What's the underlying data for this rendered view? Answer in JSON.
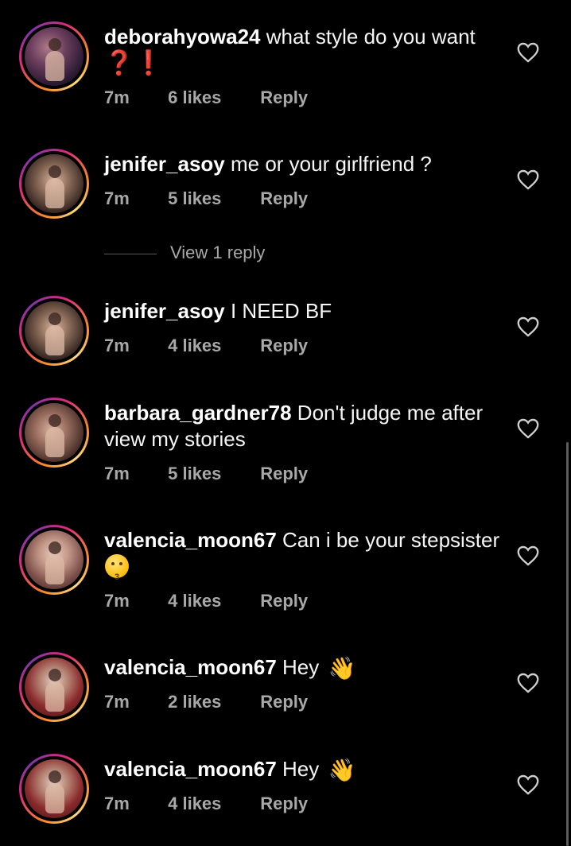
{
  "comments": [
    {
      "username": "deborahyowa24",
      "text": "what style do you want",
      "extra": "❓❗",
      "time": "7m",
      "likes": "6 likes",
      "reply": "Reply"
    },
    {
      "username": "jenifer_asoy",
      "text": "me or your girlfriend ?",
      "time": "7m",
      "likes": "5 likes",
      "reply": "Reply"
    },
    {
      "username": "jenifer_asoy",
      "text": "I NEED BF",
      "time": "7m",
      "likes": "4 likes",
      "reply": "Reply"
    },
    {
      "username": "barbara_gardner78",
      "text": "Don't judge me after view my stories",
      "time": "7m",
      "likes": "5 likes",
      "reply": "Reply"
    },
    {
      "username": "valencia_moon67",
      "text": "Can i be your stepsister",
      "emoji": "kissing-face",
      "time": "7m",
      "likes": "4 likes",
      "reply": "Reply"
    },
    {
      "username": "valencia_moon67",
      "text": "Hey",
      "emoji": "waving-hand",
      "time": "7m",
      "likes": "2 likes",
      "reply": "Reply"
    },
    {
      "username": "valencia_moon67",
      "text": "Hey",
      "emoji": "waving-hand",
      "time": "7m",
      "likes": "4 likes",
      "reply": "Reply"
    }
  ],
  "view_replies": {
    "label": "View 1 reply"
  },
  "icons": {
    "like": "heart-outline-icon",
    "wave": "👋"
  },
  "colors": {
    "background": "#000000",
    "text": "#f5f5f5",
    "muted": "#a8a8a8",
    "ring_start": "#f58529",
    "ring_mid": "#dd2a7b",
    "accent_red": "#e0242b"
  }
}
